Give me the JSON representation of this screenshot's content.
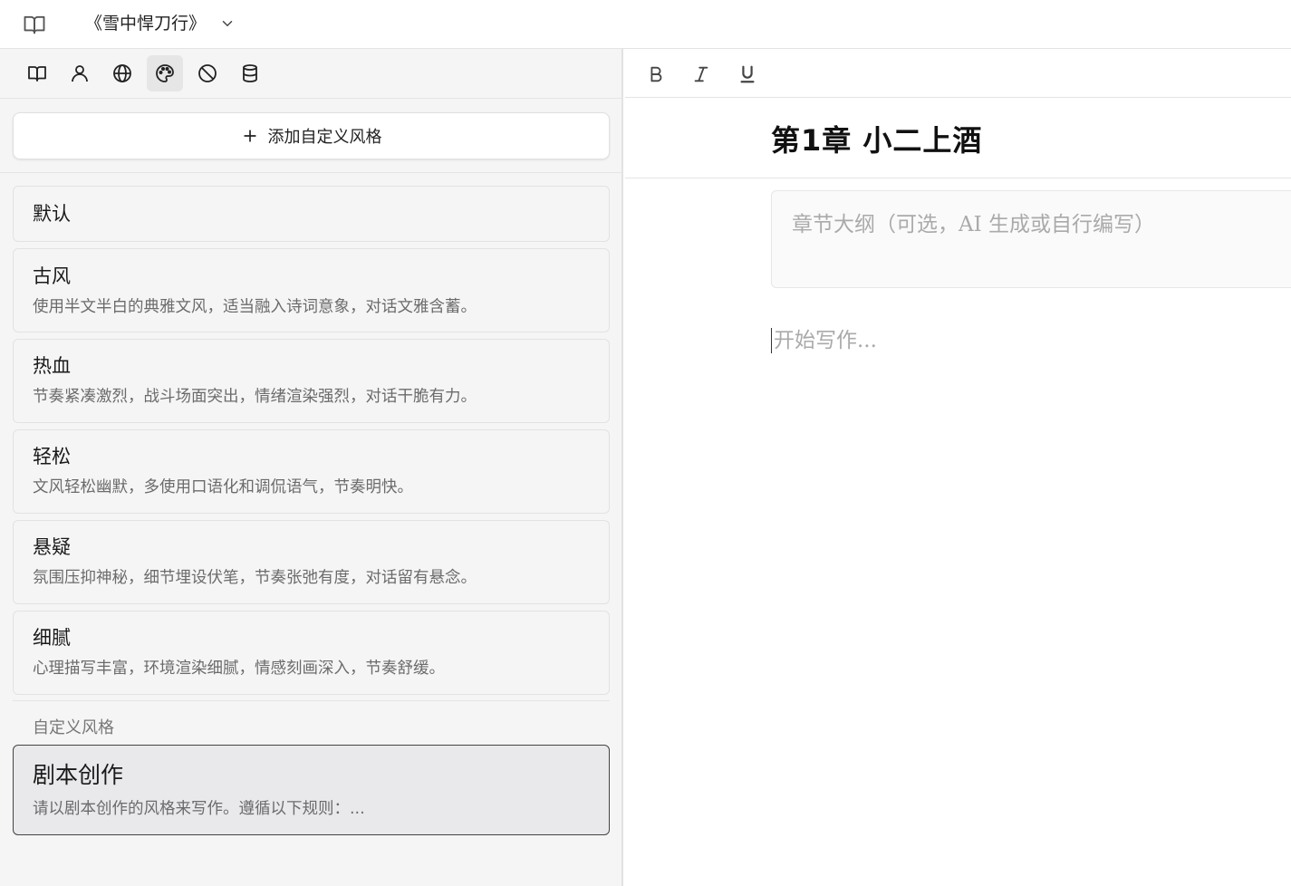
{
  "topbar": {
    "book_icon": "book-open-icon",
    "title": "《雪中悍刀行》",
    "dropdown_icon": "chevron-down-icon"
  },
  "sidebar": {
    "tabs": [
      {
        "icon": "book-open-icon",
        "active": false
      },
      {
        "icon": "user-icon",
        "active": false
      },
      {
        "icon": "globe-icon",
        "active": false
      },
      {
        "icon": "palette-icon",
        "active": true
      },
      {
        "icon": "ban-icon",
        "active": false
      },
      {
        "icon": "database-icon",
        "active": false
      }
    ],
    "add_button_label": "添加自定义风格",
    "styles": [
      {
        "name": "默认",
        "desc": ""
      },
      {
        "name": "古风",
        "desc": "使用半文半白的典雅文风，适当融入诗词意象，对话文雅含蓄。"
      },
      {
        "name": "热血",
        "desc": "节奏紧凑激烈，战斗场面突出，情绪渲染强烈，对话干脆有力。"
      },
      {
        "name": "轻松",
        "desc": "文风轻松幽默，多使用口语化和调侃语气，节奏明快。"
      },
      {
        "name": "悬疑",
        "desc": "氛围压抑神秘，细节埋设伏笔，节奏张弛有度，对话留有悬念。"
      },
      {
        "name": "细腻",
        "desc": "心理描写丰富，环境渲染细腻，情感刻画深入，节奏舒缓。"
      }
    ],
    "custom_section_label": "自定义风格",
    "custom_styles": [
      {
        "name": "剧本创作",
        "desc": "请以剧本创作的风格来写作。遵循以下规则：..."
      }
    ]
  },
  "editor": {
    "toolbar": {
      "bold_label": "B",
      "italic_label": "I",
      "underline_label": "U"
    },
    "chapter_title": "第1章  小二上酒",
    "outline_placeholder": "章节大纲（可选，AI 生成或自行编写）",
    "body_placeholder": "开始写作..."
  }
}
